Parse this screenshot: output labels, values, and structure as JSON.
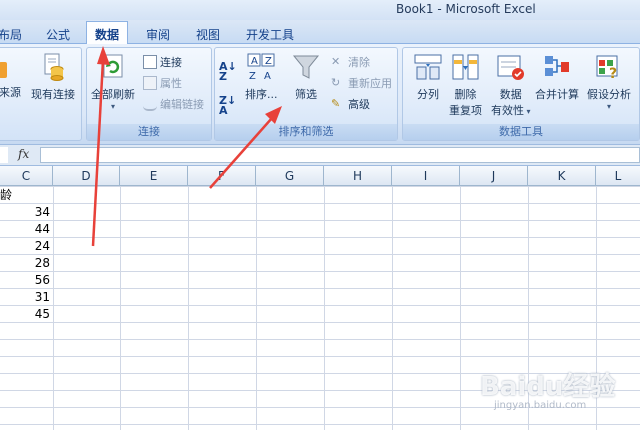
{
  "window": {
    "title": "Book1 - Microsoft Excel"
  },
  "tabs": [
    "布局",
    "公式",
    "数据",
    "审阅",
    "视图",
    "开发工具"
  ],
  "ribbon": {
    "ext_data_group": {
      "from_other": "来源",
      "existing": "现有连接"
    },
    "connections_group": {
      "label": "连接",
      "refresh_all": "全部刷新",
      "connections": "连接",
      "properties": "属性",
      "edit_links": "编辑链接"
    },
    "sort_filter_group": {
      "label": "排序和筛选",
      "sort": "排序...",
      "filter": "筛选",
      "clear": "清除",
      "reapply": "重新应用",
      "advanced": "高级"
    },
    "data_tools_group": {
      "label": "数据工具",
      "text_to_columns": "分列",
      "remove_dup_line1": "删除",
      "remove_dup_line2": "重复项",
      "validation_line1": "数据",
      "validation_line2": "有效性",
      "consolidate": "合并计算",
      "what_if": "假设分析"
    }
  },
  "formula_bar": {
    "fx_label": "fx",
    "value": ""
  },
  "columns": [
    "C",
    "D",
    "E",
    "F",
    "G",
    "H",
    "I",
    "J",
    "K",
    "L"
  ],
  "sheet": {
    "header_fragment": "龄",
    "ages": [
      "34",
      "44",
      "24",
      "28",
      "56",
      "31",
      "45"
    ]
  },
  "watermark": {
    "text": "Baidu经验",
    "url_text": "jingyan.baidu.com"
  },
  "colors": {
    "arrow": "#e8413a",
    "ribbon_text": "#15428b"
  }
}
